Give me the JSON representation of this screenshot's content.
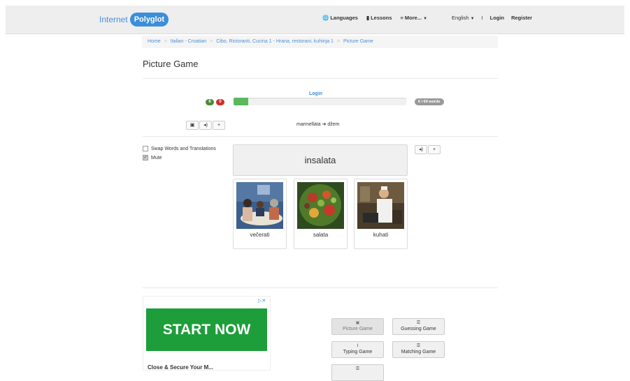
{
  "navbar": {
    "brand_a": "Internet",
    "brand_b": "Polyglot",
    "items": [
      {
        "icon": "globe-icon",
        "glyph": "🌐",
        "label": "Languages"
      },
      {
        "icon": "book-icon",
        "glyph": "▮",
        "label": "Lessons"
      },
      {
        "icon": "menu-icon",
        "glyph": "≡",
        "label": "More..."
      }
    ],
    "language": "English",
    "separator": "I",
    "login": "Login",
    "register": "Register"
  },
  "breadcrumb": [
    "Home",
    "Italian - Croatian",
    "Cibo, Ristoranti, Cucina 1 - Hrana, restorani, kuhinja 1",
    "Picture Game"
  ],
  "page_title": "Picture Game",
  "score": {
    "login_link": "Login",
    "correct": "6",
    "wrong": "0",
    "progress_fraction": 0.087,
    "words": "6 / 69 words",
    "colors": {
      "correct": "#4a8b3b",
      "wrong": "#c9302c",
      "progress": "#5cb85c"
    }
  },
  "last_translation": "marmellata ➜ džem",
  "options": [
    {
      "label": "Swap Words and Translations",
      "checked": false
    },
    {
      "label": "Mute",
      "checked": true
    }
  ],
  "current_word": "insalata",
  "cards": [
    {
      "label": "večerati",
      "image": "dinner-photo"
    },
    {
      "label": "salata",
      "image": "salad-photo"
    },
    {
      "label": "kuhati",
      "image": "cooking-photo"
    }
  ],
  "ad": {
    "cta": "START NOW",
    "text": "Close & Secure Your M..."
  },
  "games": [
    {
      "label": "Picture Game",
      "icon": "image-icon",
      "glyph": "▣"
    },
    {
      "label": "Guessing Game",
      "icon": "list-icon",
      "glyph": "☰"
    },
    {
      "label": "Typing Game",
      "icon": "text-cursor-icon",
      "glyph": "I"
    },
    {
      "label": "Matching Game",
      "icon": "list-icon",
      "glyph": "☰"
    },
    {
      "label": "",
      "icon": "list-icon",
      "glyph": "☰"
    }
  ]
}
